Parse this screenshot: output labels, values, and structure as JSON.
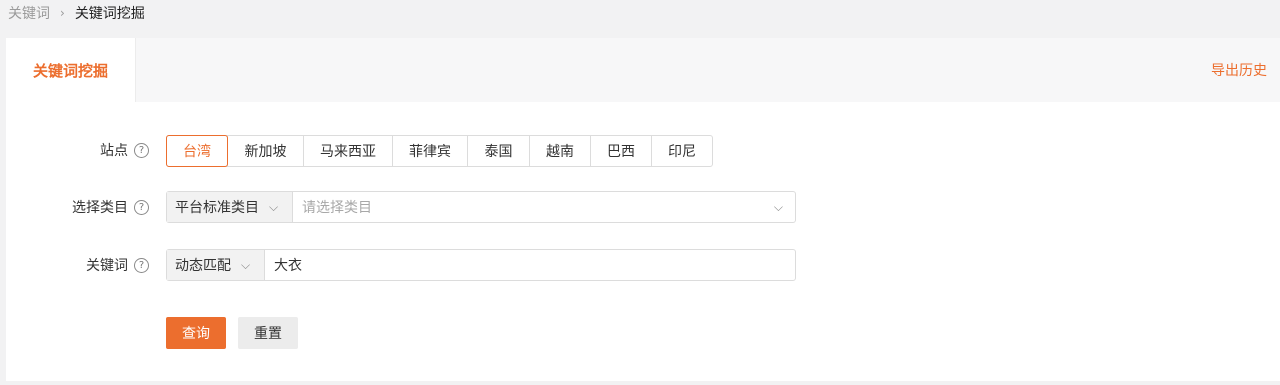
{
  "breadcrumb": {
    "parent": "关键词",
    "separator": "›",
    "current": "关键词挖掘"
  },
  "tabs": {
    "active_label": "关键词挖掘",
    "export_link": "导出历史"
  },
  "form": {
    "site": {
      "label": "站点",
      "options": [
        "台湾",
        "新加坡",
        "马来西亚",
        "菲律宾",
        "泰国",
        "越南",
        "巴西",
        "印尼"
      ],
      "selected": "台湾"
    },
    "category": {
      "label": "选择类目",
      "type_value": "平台标准类目",
      "placeholder": "请选择类目"
    },
    "keyword": {
      "label": "关键词",
      "match_mode": "动态匹配",
      "value": "大衣"
    },
    "help_glyph": "?",
    "chevron_glyph": "⌵"
  },
  "actions": {
    "query_label": "查询",
    "reset_label": "重置"
  },
  "colors": {
    "accent": "#ec6e2e",
    "page_bg": "#f2f2f3",
    "panel_bg": "#ffffff"
  }
}
